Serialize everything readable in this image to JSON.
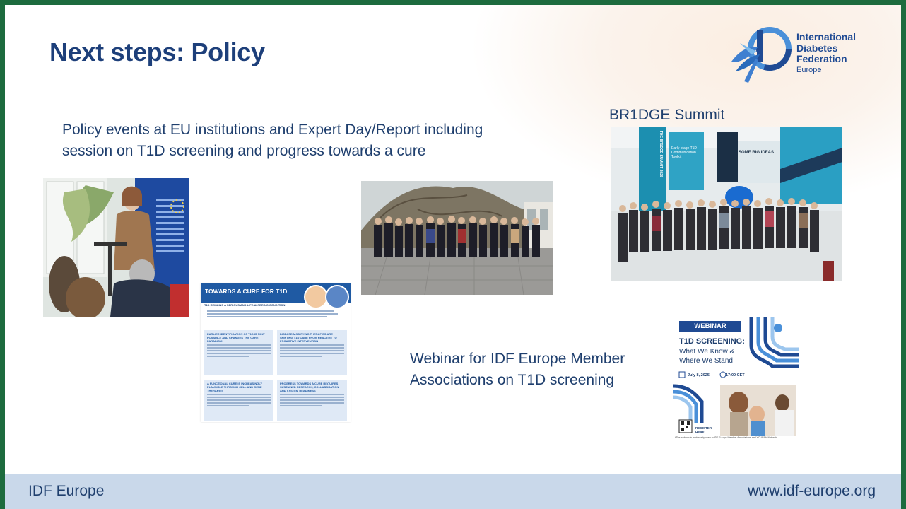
{
  "slide": {
    "title": "Next steps: Policy"
  },
  "logo": {
    "line1": "International",
    "line2": "Diabetes",
    "line3": "Federation",
    "line4": "Europe",
    "icon": "hummingbird-logo-icon"
  },
  "policy": {
    "line1": "Policy events at EU institutions and Expert Day/Report including",
    "line2": "session on T1D screening and progress towards a cure"
  },
  "bridge": {
    "label": "BR1DGE Summit",
    "banner1": "THE BR1DGE SUMMIT 2025",
    "banner2": "SOME BIG IDEAS",
    "banner3": "Early-stage T1D Communication Toolkit"
  },
  "webinar_text": {
    "line1": "Webinar for IDF Europe Member",
    "line2": "Associations on T1D screening"
  },
  "report": {
    "title": "TOWARDS A CURE FOR T1D",
    "subtitle": "T1D REMAINS A SERIOUS AND LIFE-ALTERING CONDITION",
    "box1": "EARLIER IDENTIFICATION OF T1D IS NOW POSSIBLE AND CHANGES THE CARE PARADIGM",
    "box2": "DISEASE-MODIFYING THERAPIES ARE SHIFTING T1D CARE FROM REACTIVE TO PROACTIVE INTERVENTION",
    "box3": "A FUNCTIONAL CURE IS INCREASINGLY PLAUSIBLE THROUGH CELL AND GENE THERAPIES",
    "box4": "PROGRESS TOWARDS A CURE REQUIRES SUSTAINED RESEARCH, COLLABORATION AND SYSTEM READINESS"
  },
  "webcard": {
    "badge": "WEBINAR",
    "title": "T1D SCREENING:",
    "sub1": "What We Know &",
    "sub2": "Where We Stand",
    "date": "July 8, 2025",
    "time": "17:00 CET",
    "register1": "REGISTER",
    "register2": "HERE",
    "note": "*The webinar is exclusively open to IDF Europe Member Associations and YOURAH Network."
  },
  "footer": {
    "left": "IDF Europe",
    "right": "www.idf-europe.org"
  },
  "colors": {
    "frame": "#1d6b3e",
    "title": "#1d3f7a",
    "text": "#1f3f6e",
    "footer_bg": "#c9d8ea",
    "accent": "#1f5aa3"
  }
}
